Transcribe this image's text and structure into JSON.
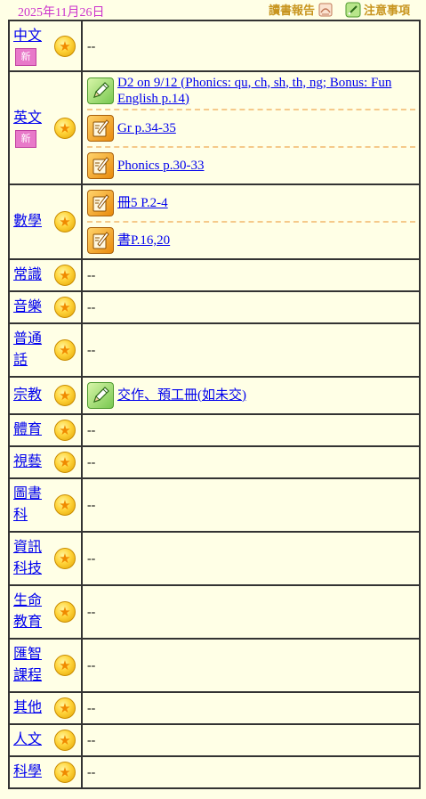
{
  "header": {
    "date": "2025年11月26日",
    "reading_report": "讀書報告",
    "notes": "注意事項"
  },
  "colors": {
    "background": "#FFFFE6",
    "date": "#CC33CC",
    "link": "#0000EE",
    "header_link": "#C8951F"
  },
  "new_badge": "新",
  "empty": "--",
  "subjects": [
    {
      "name": "中文",
      "is_new": true,
      "items": []
    },
    {
      "name": "英文",
      "is_new": true,
      "items": [
        {
          "icon": "pencil-green-icon",
          "text": "D2 on 9/12 (Phonics: qu, ch, sh, th, ng; Bonus: Fun English p.14)"
        },
        {
          "icon": "writing-orange-icon",
          "text": "Gr p.34-35"
        },
        {
          "icon": "writing-orange-icon",
          "text": "Phonics p.30-33"
        }
      ]
    },
    {
      "name": "數學",
      "is_new": false,
      "items": [
        {
          "icon": "writing-orange-icon",
          "text": "冊5 P.2-4"
        },
        {
          "icon": "writing-orange-icon",
          "text": "書P.16,20"
        }
      ]
    },
    {
      "name": "常識",
      "is_new": false,
      "items": []
    },
    {
      "name": "音樂",
      "is_new": false,
      "items": []
    },
    {
      "name": "普通話",
      "is_new": false,
      "items": []
    },
    {
      "name": "宗教",
      "is_new": false,
      "items": [
        {
          "icon": "pencil-green-icon",
          "text": "交作、預工冊(如未交)"
        }
      ]
    },
    {
      "name": "體育",
      "is_new": false,
      "items": []
    },
    {
      "name": "視藝",
      "is_new": false,
      "items": []
    },
    {
      "name": "圖書科",
      "is_new": false,
      "items": []
    },
    {
      "name": "資訊科技",
      "is_new": false,
      "items": []
    },
    {
      "name": "生命教育",
      "is_new": false,
      "items": []
    },
    {
      "name": "匯智課程",
      "is_new": false,
      "items": []
    },
    {
      "name": "其他",
      "is_new": false,
      "items": []
    },
    {
      "name": "人文",
      "is_new": false,
      "items": []
    },
    {
      "name": "科學",
      "is_new": false,
      "items": []
    }
  ]
}
